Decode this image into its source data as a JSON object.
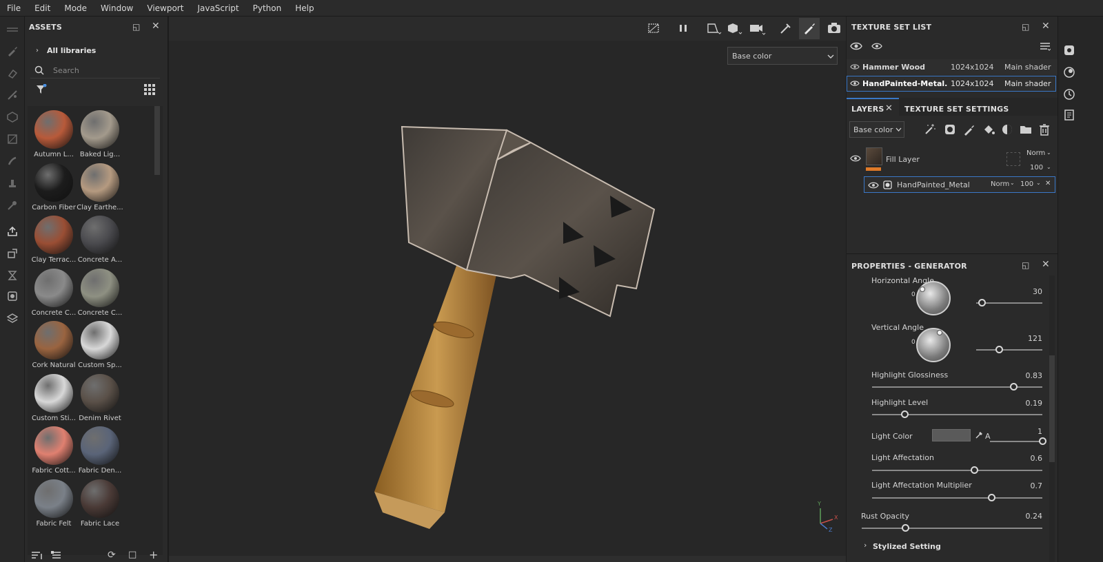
{
  "menu": [
    "File",
    "Edit",
    "Mode",
    "Window",
    "Viewport",
    "JavaScript",
    "Python",
    "Help"
  ],
  "assets": {
    "title": "ASSETS",
    "library": "All libraries",
    "search_placeholder": "Search",
    "items": [
      {
        "label": "Autumn L...",
        "color": "#b85a3a"
      },
      {
        "label": "Baked Lig...",
        "color": "#a39a8c"
      },
      {
        "label": "Carbon Fiber",
        "color": "#1c1c1c"
      },
      {
        "label": "Clay Earthe...",
        "color": "#b59a80"
      },
      {
        "label": "Clay Terrac...",
        "color": "#9a4e34"
      },
      {
        "label": "Concrete A...",
        "color": "#4a4a4e"
      },
      {
        "label": "Concrete C...",
        "color": "#8a8a8a"
      },
      {
        "label": "Concrete C...",
        "color": "#8e9082"
      },
      {
        "label": "Cork Natural",
        "color": "#9a6440"
      },
      {
        "label": "Custom Sp...",
        "color": "#d8d8d8"
      },
      {
        "label": "Custom Sti...",
        "color": "#d8d8d8"
      },
      {
        "label": "Denim Rivet",
        "color": "#5a5048"
      },
      {
        "label": "Fabric Cott...",
        "color": "#e08070"
      },
      {
        "label": "Fabric Den...",
        "color": "#5a6478"
      },
      {
        "label": "Fabric Felt",
        "color": "#7a8088"
      },
      {
        "label": "Fabric Lace",
        "color": "#4a3a36"
      }
    ]
  },
  "viewport": {
    "channel": "Base color",
    "axis": {
      "y": "Y",
      "x": "X",
      "z": "Z"
    }
  },
  "texture_set_list": {
    "title": "TEXTURE SET LIST",
    "rows": [
      {
        "name": "Hammer Wood",
        "size": "1024x1024",
        "shader": "Main shader"
      },
      {
        "name": "HandPainted-Metal.",
        "size": "1024x1024",
        "shader": "Main shader"
      }
    ]
  },
  "layers": {
    "tab_layers": "LAYERS",
    "tab_settings": "TEXTURE SET SETTINGS",
    "channel": "Base color",
    "fill_layer": {
      "name": "Fill Layer",
      "blend": "Norm",
      "opacity": "100"
    },
    "generator": {
      "name": "HandPainted_Metal",
      "blend": "Norm",
      "opacity": "100"
    }
  },
  "properties": {
    "title": "PROPERTIES - GENERATOR",
    "horizontal_angle": {
      "label": "Horizontal Angle",
      "value": "30",
      "dial_zero": "0",
      "fraction": 0.08
    },
    "vertical_angle": {
      "label": "Vertical Angle",
      "value": "121",
      "dial_zero": "0",
      "fraction": 0.34
    },
    "highlight_glossiness": {
      "label": "Highlight Glossiness",
      "value": "0.83",
      "fraction": 0.83
    },
    "highlight_level": {
      "label": "Highlight Level",
      "value": "0.19",
      "fraction": 0.19
    },
    "light_color": {
      "label": "Light Color",
      "alpha_label": "A",
      "alpha_value": "1",
      "color": "#5a5a5a"
    },
    "light_affectation": {
      "label": "Light Affectation",
      "value": "0.6",
      "fraction": 0.6
    },
    "light_affectation_multiplier": {
      "label": "Light Affectation Multiplier",
      "value": "0.7",
      "fraction": 0.7
    },
    "rust_opacity": {
      "label": "Rust Opacity",
      "value": "0.24",
      "fraction": 0.24
    },
    "stylized_setting": "Stylized Setting"
  }
}
